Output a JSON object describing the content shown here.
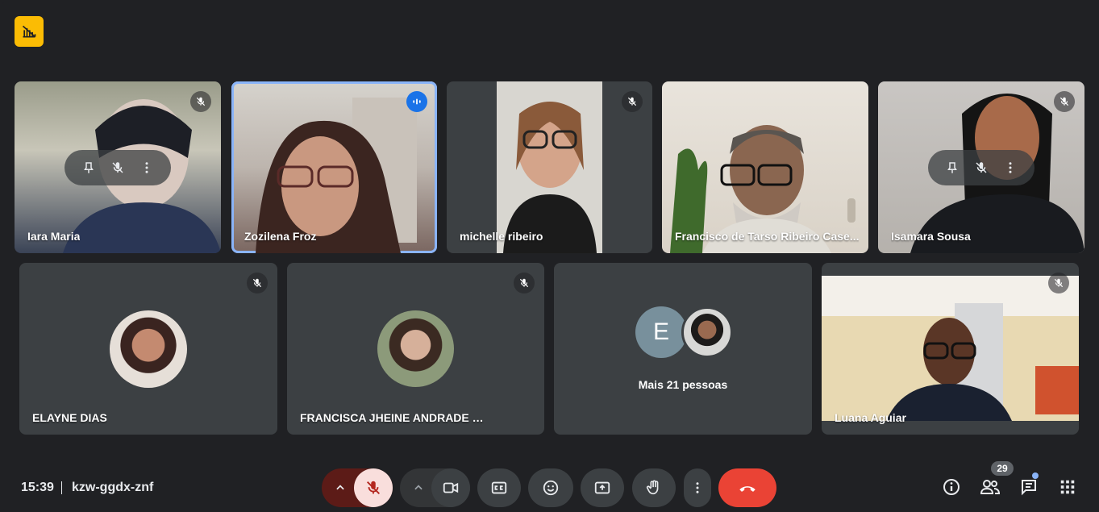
{
  "meeting": {
    "time": "15:39",
    "code": "kzw-ggdx-znf",
    "participants_count": "29"
  },
  "row1": [
    {
      "name": "Iara Maria",
      "muted": true
    },
    {
      "name": "Zozilena Froz",
      "speaking": true
    },
    {
      "name": "michelle ribeiro",
      "muted": true
    },
    {
      "name": "Francisco de Tarso Ribeiro Case...",
      "muted": false
    },
    {
      "name": "Isamara Sousa",
      "muted": true
    }
  ],
  "row2": [
    {
      "name": "ELAYNE DIAS",
      "muted": true
    },
    {
      "name": "FRANCISCA JHEINE ANDRADE CUNHA",
      "muted": true
    },
    {
      "name": "",
      "more_label": "Mais 21 pessoas",
      "avatar_letter": "E"
    },
    {
      "name": "Luana Aguiar",
      "muted": true
    }
  ],
  "colors": {
    "background": "#202124",
    "tile": "#3c4043",
    "speaking_outline": "#8ab4f8",
    "end_call": "#ea4335",
    "mic_off_bg": "#f9dedc",
    "mic_off_fg": "#b3261e",
    "badge_yellow": "#fbbc04",
    "avatar_e": "#78909c"
  },
  "icons": {
    "top_badge": "no-signal-icon",
    "mic_chevron": "chevron-up-icon",
    "mic": "mic-off-icon",
    "cam_chevron": "chevron-up-icon",
    "camera": "videocam-icon",
    "captions": "closed-caption-icon",
    "reactions": "emoji-icon",
    "present": "present-screen-icon",
    "raise_hand": "hand-icon",
    "more": "more-vert-icon",
    "end_call": "call-end-icon",
    "info": "info-icon",
    "people": "people-icon",
    "chat": "chat-icon",
    "activities": "apps-icon"
  }
}
